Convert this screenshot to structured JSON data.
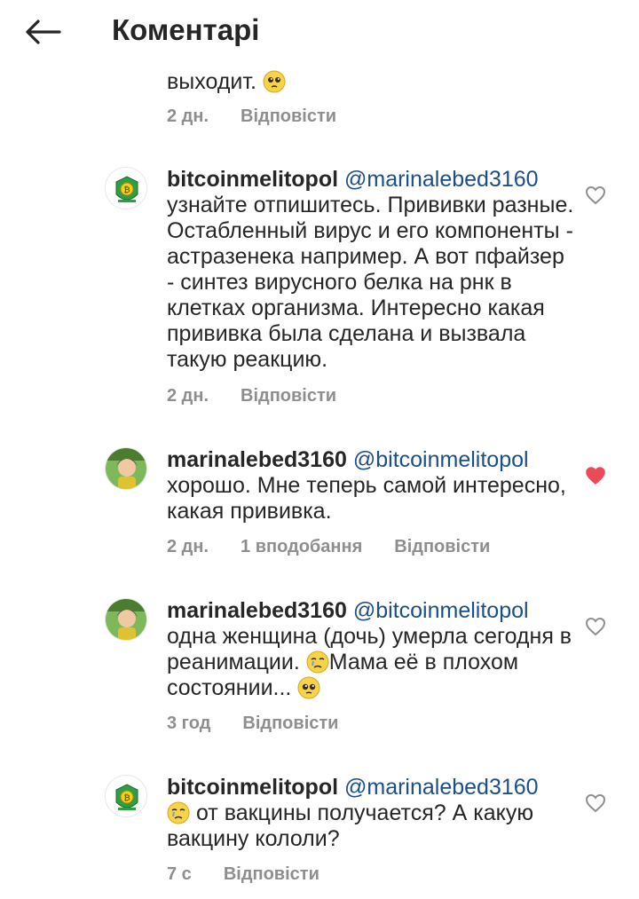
{
  "header": {
    "title": "Коментарі",
    "back_icon": "arrow-left-icon"
  },
  "comments": [
    {
      "text_tail": "выходит.",
      "emoji": "pleading-face",
      "time": "2 дн.",
      "reply_label": "Відповісти"
    },
    {
      "username": "bitcoinmelitopol",
      "mention": "@marinalebed3160",
      "text": "узнайте отпишитесь. Прививки разные. Остабленный вирус и его компоненты - астразенека например. А вот пфайзер - синтез вирусного белка на рнк в клетках организма. Интересно какая прививка была сделана и вызвала такую реакцию.",
      "time": "2 дн.",
      "reply_label": "Відповісти",
      "liked": false
    },
    {
      "username": "marinalebed3160",
      "mention": "@bitcoinmelitopol",
      "text": "хорошо. Мне теперь самой интересно, какая прививка.",
      "time": "2 дн.",
      "likes_label": "1 вподобання",
      "reply_label": "Відповісти",
      "liked": true
    },
    {
      "username": "marinalebed3160",
      "mention": "@bitcoinmelitopol",
      "text_part1": "одна женщина (дочь) умерла сегодня в реанимации.",
      "text_part2": "Мама её в плохом состоянии...",
      "time": "3 год",
      "reply_label": "Відповісти",
      "liked": false
    },
    {
      "username": "bitcoinmelitopol",
      "mention": "@marinalebed3160",
      "text": "от вакцины получается? А какую вакцину кололи?",
      "time": "7 с",
      "reply_label": "Відповісти",
      "liked": false
    }
  ],
  "colors": {
    "text": "#262626",
    "secondary": "#8e8e8e",
    "mention": "#1a4f89",
    "like_active": "#ed4956"
  }
}
